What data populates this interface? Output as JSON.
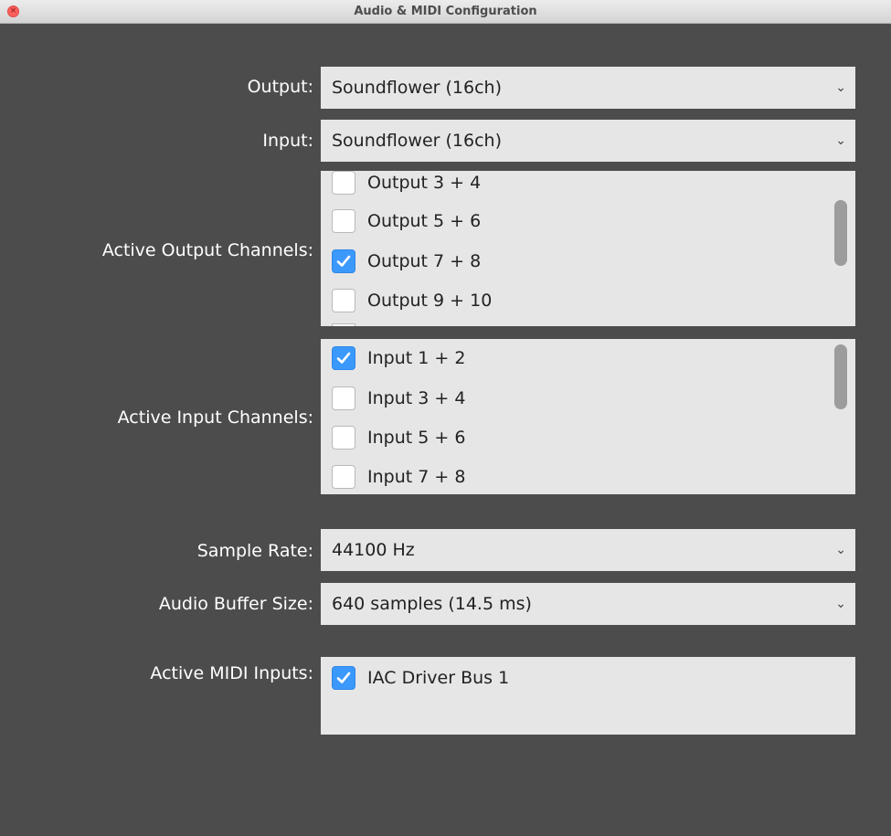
{
  "window": {
    "title": "Audio & MIDI Configuration"
  },
  "output": {
    "label": "Output:",
    "value": "Soundflower (16ch)"
  },
  "input": {
    "label": "Input:",
    "value": "Soundflower (16ch)"
  },
  "active_output_channels": {
    "label": "Active Output Channels:",
    "items": [
      {
        "label": "Output 3 + 4",
        "checked": false
      },
      {
        "label": "Output 5 + 6",
        "checked": false
      },
      {
        "label": "Output 7 + 8",
        "checked": true
      },
      {
        "label": "Output 9 + 10",
        "checked": false
      }
    ]
  },
  "active_input_channels": {
    "label": "Active Input Channels:",
    "items": [
      {
        "label": "Input 1 + 2",
        "checked": true
      },
      {
        "label": "Input 3 + 4",
        "checked": false
      },
      {
        "label": "Input 5 + 6",
        "checked": false
      },
      {
        "label": "Input 7 + 8",
        "checked": false
      }
    ]
  },
  "sample_rate": {
    "label": "Sample Rate:",
    "value": "44100 Hz"
  },
  "buffer_size": {
    "label": "Audio Buffer Size:",
    "value": "640 samples (14.5 ms)"
  },
  "midi_inputs": {
    "label": "Active MIDI Inputs:",
    "items": [
      {
        "label": "IAC Driver Bus 1",
        "checked": true
      }
    ]
  },
  "colors": {
    "accent": "#3b99fc",
    "background": "#4c4c4c",
    "field": "#e6e6e6"
  },
  "icons": {
    "close": "close-icon",
    "dropdown": "chevron-down-icon",
    "check": "checkmark-icon"
  }
}
